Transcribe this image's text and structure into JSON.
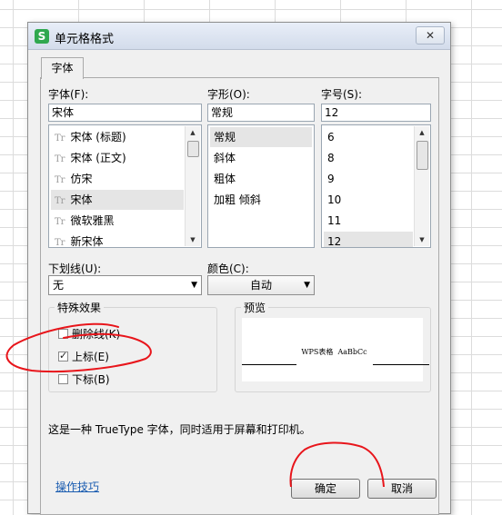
{
  "dialog": {
    "title": "单元格格式",
    "app_icon_letter": "S",
    "close_glyph": "✕",
    "tab": "字体"
  },
  "font": {
    "label": "字体(F):",
    "value": "宋体",
    "items": [
      "宋体 (标题)",
      "宋体 (正文)",
      "仿宋",
      "宋体",
      "微软雅黑",
      "新宋体"
    ],
    "selected": "宋体",
    "item_icon": "Tr"
  },
  "style": {
    "label": "字形(O):",
    "value": "常规",
    "items": [
      "常规",
      "斜体",
      "粗体",
      "加粗 倾斜"
    ],
    "selected": "常规"
  },
  "size": {
    "label": "字号(S):",
    "value": "12",
    "items": [
      "6",
      "8",
      "9",
      "10",
      "11",
      "12"
    ],
    "selected": "12"
  },
  "underline": {
    "label": "下划线(U):",
    "value": "无"
  },
  "color": {
    "label": "颜色(C):",
    "value": "自动"
  },
  "effects": {
    "title": "特殊效果",
    "items": [
      {
        "label": "删除线(K)",
        "checked": false
      },
      {
        "label": "上标(E)",
        "checked": true
      },
      {
        "label": "下标(B)",
        "checked": false
      }
    ]
  },
  "preview": {
    "title": "预览",
    "sample": "WPS表格  AaBbCc"
  },
  "note": "这是一种 TrueType 字体，同时适用于屏幕和打印机。",
  "footer": {
    "link": "操作技巧",
    "ok": "确定",
    "cancel": "取消"
  },
  "annotation_color": "#e8151b"
}
